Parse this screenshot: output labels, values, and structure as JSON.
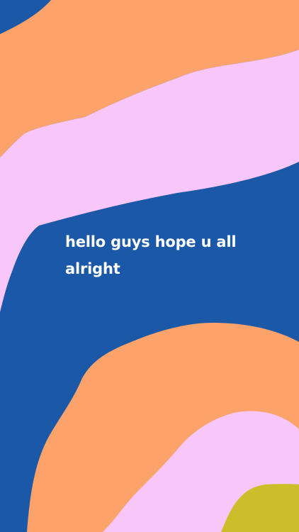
{
  "story": {
    "caption": "hello guys hope u all alright"
  },
  "colors": {
    "background_blue": "#1c58a8",
    "orange": "#fba36a",
    "pink": "#f8c6f8",
    "olive": "#cdbd2a",
    "text": "#ffffff"
  }
}
